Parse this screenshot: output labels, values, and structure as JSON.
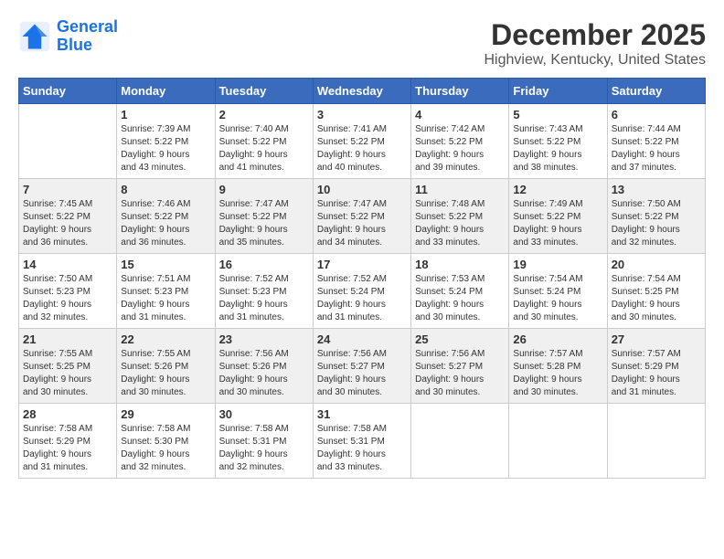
{
  "header": {
    "logo_line1": "General",
    "logo_line2": "Blue",
    "month": "December 2025",
    "location": "Highview, Kentucky, United States"
  },
  "days_of_week": [
    "Sunday",
    "Monday",
    "Tuesday",
    "Wednesday",
    "Thursday",
    "Friday",
    "Saturday"
  ],
  "weeks": [
    [
      {
        "day": "",
        "info": ""
      },
      {
        "day": "1",
        "info": "Sunrise: 7:39 AM\nSunset: 5:22 PM\nDaylight: 9 hours\nand 43 minutes."
      },
      {
        "day": "2",
        "info": "Sunrise: 7:40 AM\nSunset: 5:22 PM\nDaylight: 9 hours\nand 41 minutes."
      },
      {
        "day": "3",
        "info": "Sunrise: 7:41 AM\nSunset: 5:22 PM\nDaylight: 9 hours\nand 40 minutes."
      },
      {
        "day": "4",
        "info": "Sunrise: 7:42 AM\nSunset: 5:22 PM\nDaylight: 9 hours\nand 39 minutes."
      },
      {
        "day": "5",
        "info": "Sunrise: 7:43 AM\nSunset: 5:22 PM\nDaylight: 9 hours\nand 38 minutes."
      },
      {
        "day": "6",
        "info": "Sunrise: 7:44 AM\nSunset: 5:22 PM\nDaylight: 9 hours\nand 37 minutes."
      }
    ],
    [
      {
        "day": "7",
        "info": "Sunrise: 7:45 AM\nSunset: 5:22 PM\nDaylight: 9 hours\nand 36 minutes."
      },
      {
        "day": "8",
        "info": "Sunrise: 7:46 AM\nSunset: 5:22 PM\nDaylight: 9 hours\nand 36 minutes."
      },
      {
        "day": "9",
        "info": "Sunrise: 7:47 AM\nSunset: 5:22 PM\nDaylight: 9 hours\nand 35 minutes."
      },
      {
        "day": "10",
        "info": "Sunrise: 7:47 AM\nSunset: 5:22 PM\nDaylight: 9 hours\nand 34 minutes."
      },
      {
        "day": "11",
        "info": "Sunrise: 7:48 AM\nSunset: 5:22 PM\nDaylight: 9 hours\nand 33 minutes."
      },
      {
        "day": "12",
        "info": "Sunrise: 7:49 AM\nSunset: 5:22 PM\nDaylight: 9 hours\nand 33 minutes."
      },
      {
        "day": "13",
        "info": "Sunrise: 7:50 AM\nSunset: 5:22 PM\nDaylight: 9 hours\nand 32 minutes."
      }
    ],
    [
      {
        "day": "14",
        "info": "Sunrise: 7:50 AM\nSunset: 5:23 PM\nDaylight: 9 hours\nand 32 minutes."
      },
      {
        "day": "15",
        "info": "Sunrise: 7:51 AM\nSunset: 5:23 PM\nDaylight: 9 hours\nand 31 minutes."
      },
      {
        "day": "16",
        "info": "Sunrise: 7:52 AM\nSunset: 5:23 PM\nDaylight: 9 hours\nand 31 minutes."
      },
      {
        "day": "17",
        "info": "Sunrise: 7:52 AM\nSunset: 5:24 PM\nDaylight: 9 hours\nand 31 minutes."
      },
      {
        "day": "18",
        "info": "Sunrise: 7:53 AM\nSunset: 5:24 PM\nDaylight: 9 hours\nand 30 minutes."
      },
      {
        "day": "19",
        "info": "Sunrise: 7:54 AM\nSunset: 5:24 PM\nDaylight: 9 hours\nand 30 minutes."
      },
      {
        "day": "20",
        "info": "Sunrise: 7:54 AM\nSunset: 5:25 PM\nDaylight: 9 hours\nand 30 minutes."
      }
    ],
    [
      {
        "day": "21",
        "info": "Sunrise: 7:55 AM\nSunset: 5:25 PM\nDaylight: 9 hours\nand 30 minutes."
      },
      {
        "day": "22",
        "info": "Sunrise: 7:55 AM\nSunset: 5:26 PM\nDaylight: 9 hours\nand 30 minutes."
      },
      {
        "day": "23",
        "info": "Sunrise: 7:56 AM\nSunset: 5:26 PM\nDaylight: 9 hours\nand 30 minutes."
      },
      {
        "day": "24",
        "info": "Sunrise: 7:56 AM\nSunset: 5:27 PM\nDaylight: 9 hours\nand 30 minutes."
      },
      {
        "day": "25",
        "info": "Sunrise: 7:56 AM\nSunset: 5:27 PM\nDaylight: 9 hours\nand 30 minutes."
      },
      {
        "day": "26",
        "info": "Sunrise: 7:57 AM\nSunset: 5:28 PM\nDaylight: 9 hours\nand 30 minutes."
      },
      {
        "day": "27",
        "info": "Sunrise: 7:57 AM\nSunset: 5:29 PM\nDaylight: 9 hours\nand 31 minutes."
      }
    ],
    [
      {
        "day": "28",
        "info": "Sunrise: 7:58 AM\nSunset: 5:29 PM\nDaylight: 9 hours\nand 31 minutes."
      },
      {
        "day": "29",
        "info": "Sunrise: 7:58 AM\nSunset: 5:30 PM\nDaylight: 9 hours\nand 32 minutes."
      },
      {
        "day": "30",
        "info": "Sunrise: 7:58 AM\nSunset: 5:31 PM\nDaylight: 9 hours\nand 32 minutes."
      },
      {
        "day": "31",
        "info": "Sunrise: 7:58 AM\nSunset: 5:31 PM\nDaylight: 9 hours\nand 33 minutes."
      },
      {
        "day": "",
        "info": ""
      },
      {
        "day": "",
        "info": ""
      },
      {
        "day": "",
        "info": ""
      }
    ]
  ]
}
